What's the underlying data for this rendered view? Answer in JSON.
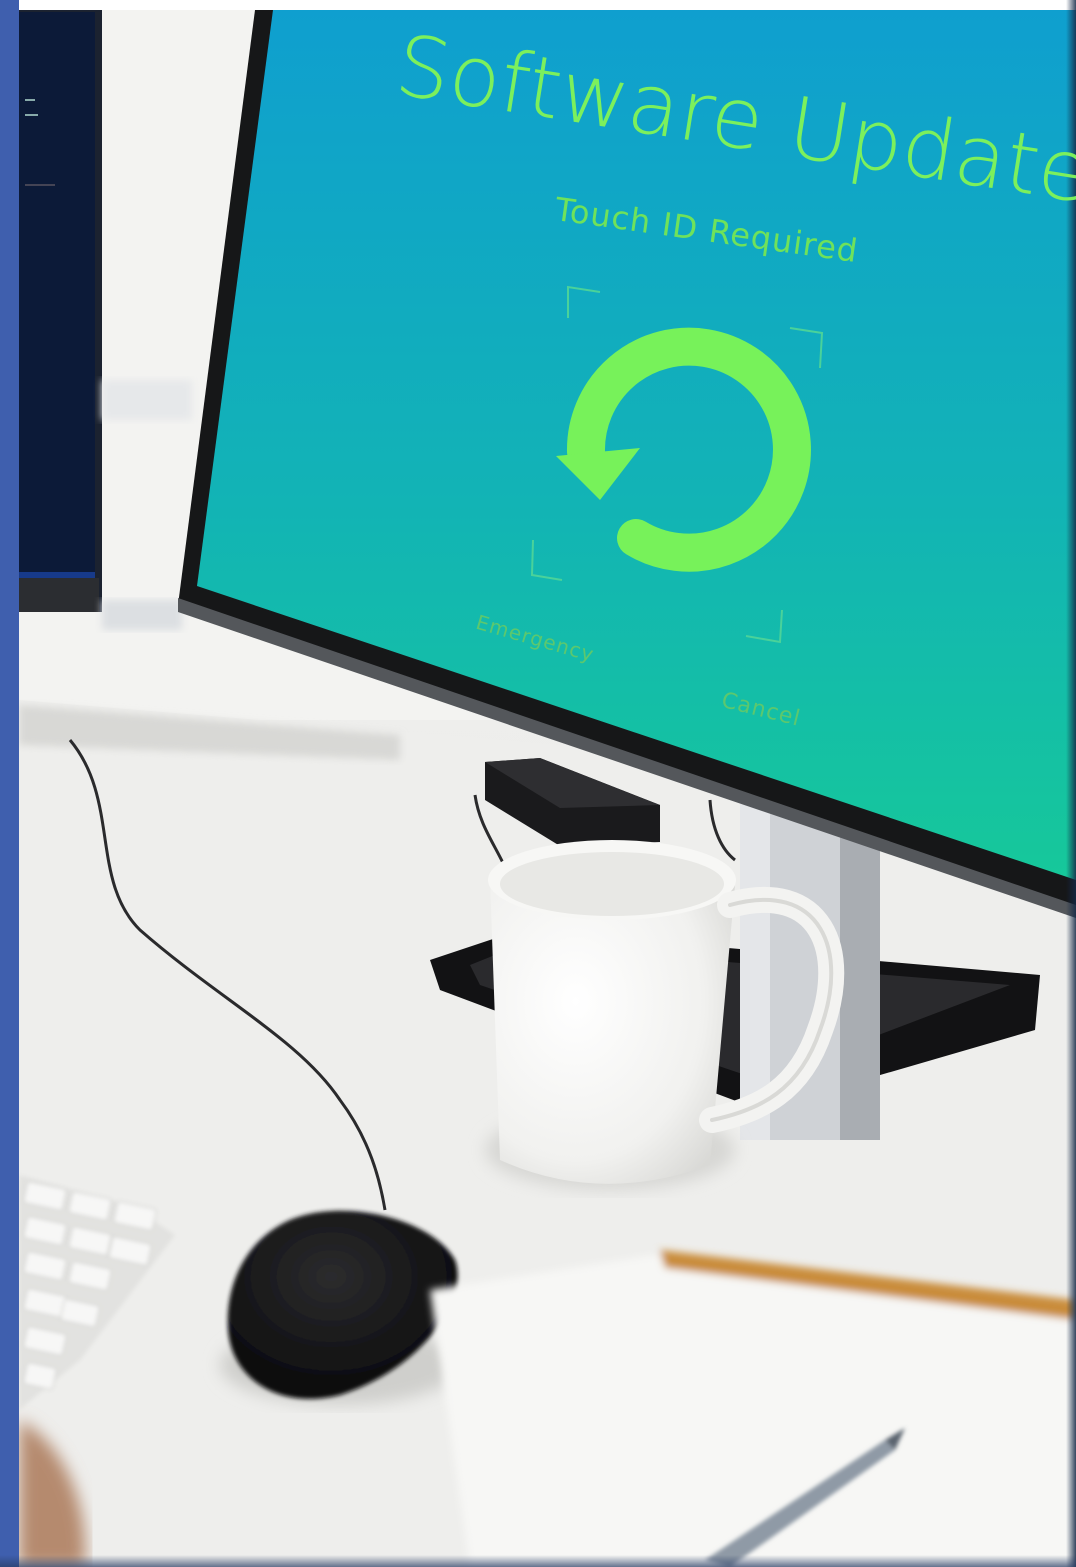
{
  "screen": {
    "title": "Software Update",
    "subtitle": "Touch ID Required",
    "emergency_label": "Emergency",
    "cancel_label": "Cancel",
    "icon": "refresh-arrow-icon"
  },
  "colors": {
    "screen_top": "#0f9fcf",
    "screen_bottom": "#16c89a",
    "screen_text": "#7cf05c",
    "icon": "#77f25a",
    "side_bar": "#3f5fae",
    "desk": "#f0f0ee"
  }
}
